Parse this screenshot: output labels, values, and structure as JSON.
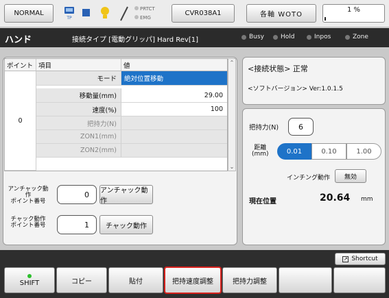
{
  "topbar": {
    "mode": "NORMAL",
    "tp_label": "TP",
    "prtct": "PRTCT",
    "emg": "EMG",
    "unit": "CVR038A1",
    "axis": "各軸 WOTO",
    "speed_text": "1 %",
    "speed_fraction": 0.01
  },
  "title": {
    "name": "ハンド",
    "connection": "接続タイプ [電動グリッパ]  Hard Rev[1]",
    "status": [
      "Busy",
      "Hold",
      "Inpos",
      "Zone"
    ]
  },
  "table": {
    "headers": [
      "ポイント",
      "項目",
      "値"
    ],
    "point": "0",
    "rows": [
      {
        "label": "モード",
        "value": "絶対位置移動"
      },
      {
        "label": "移動量(mm)",
        "value": "29.00"
      },
      {
        "label": "速度(%)",
        "value": "100"
      },
      {
        "label": "把持力(N)",
        "value": ""
      },
      {
        "label": "ZON1(mm)",
        "value": ""
      },
      {
        "label": "ZON2(mm)",
        "value": ""
      }
    ]
  },
  "unchuck": {
    "label_line1": "アンチャック動作",
    "label_line2": "ポイント番号",
    "value": "0",
    "button": "アンチャック動作"
  },
  "chuck": {
    "label_line1": "チャック動作",
    "label_line2": "ポイント番号",
    "value": "1",
    "button": "チャック動作"
  },
  "status_panel": {
    "conn_state": "<接続状態> 正常",
    "software": "<ソフトバージョン> Ver:1.0.1.5"
  },
  "control": {
    "grip_label": "把持力(N)",
    "grip_value": "6",
    "distance_label_1": "距離",
    "distance_label_2": "(mm)",
    "distance_options": [
      "0.01",
      "0.10",
      "1.00"
    ],
    "selected_distance": "0.01",
    "inching_label": "インチング動作",
    "inching_value": "無効",
    "position_label": "現在位置",
    "position_value": "20.64",
    "position_unit": "mm"
  },
  "bottombar": {
    "shortcut": "Shortcut",
    "buttons": [
      "SHIFT",
      "コピー",
      "貼付",
      "把持速度調整",
      "把持力調整",
      "",
      ""
    ]
  }
}
